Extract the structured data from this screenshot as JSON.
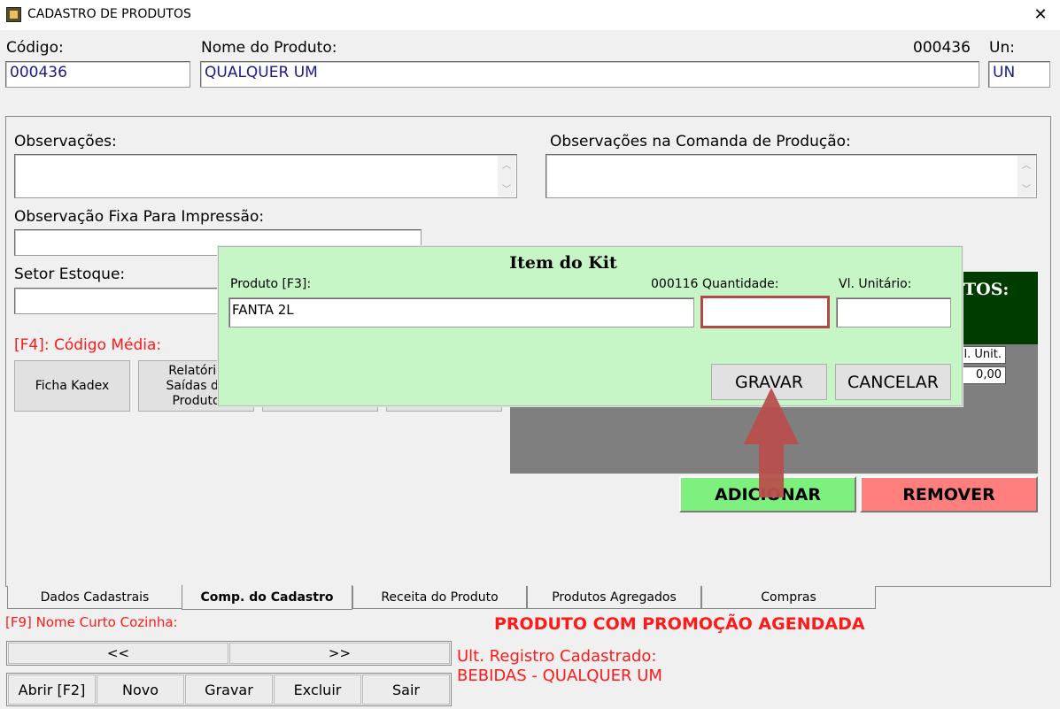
{
  "window": {
    "title": "CADASTRO DE PRODUTOS",
    "close_glyph": "✕"
  },
  "header": {
    "codigo_label": "Código:",
    "codigo_value": "000436",
    "nome_label": "Nome do Produto:",
    "nome_value": "QUALQUER UM",
    "code_display": "000436",
    "un_label": "Un:",
    "un_value": "UN"
  },
  "form": {
    "obs_label": "Observações:",
    "obs_comanda_label": "Observações na Comanda de Produção:",
    "obs_fixa_label": "Observação Fixa Para Impressão:",
    "setor_label": "Setor Estoque:",
    "f4_label": "[F4]: Código Média:",
    "ficha_button": "Ficha Kadex",
    "relatorio_button": "Relatório Saídas do Produto"
  },
  "kit_panel": {
    "title_partial": "TOS:",
    "unit_header": "l. Unit.",
    "unit_value": "0,00",
    "adicionar_button": "ADICIONAR",
    "remover_button": "REMOVER"
  },
  "dialog": {
    "title": "Item do Kit",
    "produto_label": "Produto [F3]:",
    "produto_code": "000116",
    "produto_value": "FANTA 2L",
    "quantidade_label": "Quantidade:",
    "quantidade_value": "",
    "vl_unitario_label": "Vl. Unitário:",
    "vl_unitario_value": "",
    "gravar_button": "GRAVAR",
    "cancelar_button": "CANCELAR"
  },
  "tabs": [
    {
      "label": "Dados Cadastrais"
    },
    {
      "label": "Comp. do Cadastro",
      "active": true
    },
    {
      "label": "Receita do Produto"
    },
    {
      "label": "Produtos Agregados"
    },
    {
      "label": "Compras"
    }
  ],
  "footer": {
    "f9_label": "[F9] Nome Curto Cozinha:",
    "promo_text": "PRODUTO COM PROMOÇÃO AGENDADA",
    "prev_button": "<<",
    "next_button": ">>",
    "ult_label": "Ult. Registro Cadastrado:",
    "ult_value": "BEBIDAS - QUALQUER UM",
    "abrir": "Abrir [F2]",
    "novo": "Novo",
    "gravar": "Gravar",
    "excluir": "Excluir",
    "sair": "Sair"
  },
  "colors": {
    "dialog_bg": "#c6f5c6",
    "panel_dark_green": "#003b00",
    "adicionar_bg": "#7ef07e",
    "remover_bg": "#ff7f7f",
    "label_red": "#ff1a1a",
    "arrow": "#b8504d"
  }
}
